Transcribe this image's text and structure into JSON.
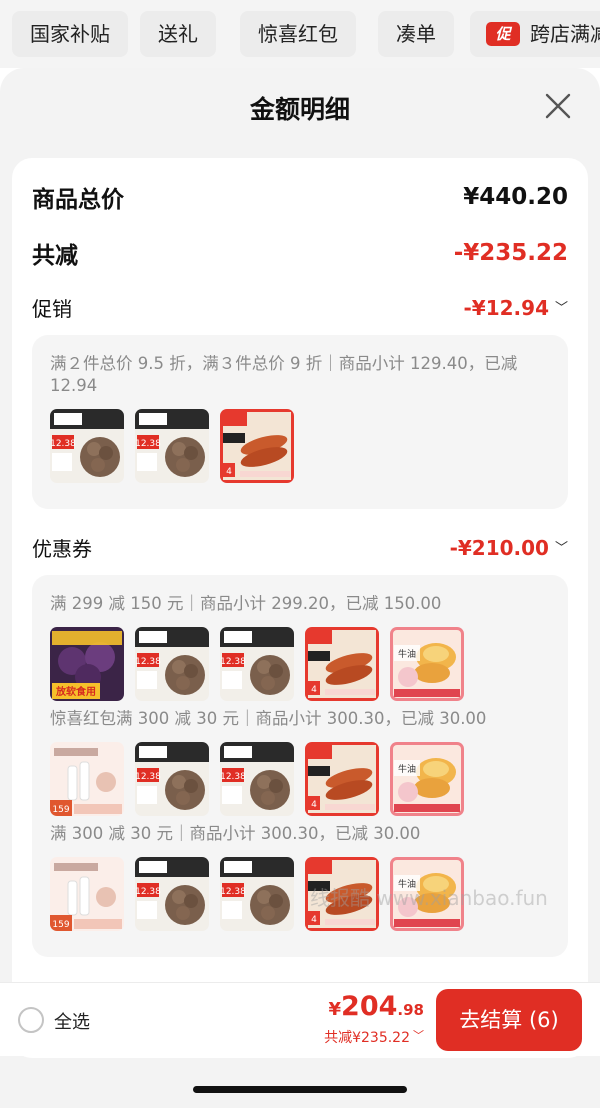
{
  "top_tabs": {
    "items": [
      "国家补贴",
      "送礼",
      "惊喜红包",
      "凑单"
    ],
    "promo_badge": "促",
    "promo_label": "跨店满减"
  },
  "sheet": {
    "title": "金额明细",
    "close_icon": "close-icon"
  },
  "summary": {
    "goods_total_label": "商品总价",
    "goods_total_value": "¥440.20",
    "reduce_label": "共减",
    "reduce_value": "-¥235.22"
  },
  "promotion": {
    "label": "促销",
    "value": "-¥12.94",
    "rule": "满２件总价 9.5 折，满３件总价 9 折｜商品小计 129.40，已减 12.94",
    "thumbs": [
      {
        "type": "beef",
        "tag": "12.38"
      },
      {
        "type": "beef",
        "tag": "12.38"
      },
      {
        "type": "sausage",
        "tag": "4"
      }
    ]
  },
  "coupons": {
    "label": "优惠券",
    "value": "-¥210.00",
    "groups": [
      {
        "rule": "满 299 减 150 元｜商品小计 299.20，已减 150.00",
        "thumbs": [
          {
            "type": "plum",
            "tag": "放软食用"
          },
          {
            "type": "beef",
            "tag": "12.38"
          },
          {
            "type": "beef",
            "tag": "12.38"
          },
          {
            "type": "sausage",
            "tag": "4"
          },
          {
            "type": "tart",
            "tag": "牛油"
          }
        ]
      },
      {
        "rule": "惊喜红包满 300 减 30 元｜商品小计 300.30，已减 30.00",
        "thumbs": [
          {
            "type": "cosmetic",
            "tag": "159"
          },
          {
            "type": "beef",
            "tag": "12.38"
          },
          {
            "type": "beef",
            "tag": "12.38"
          },
          {
            "type": "sausage",
            "tag": "4"
          },
          {
            "type": "tart",
            "tag": "牛油"
          }
        ]
      },
      {
        "rule": "满 300 减 30 元｜商品小计 300.30，已减 30.00",
        "thumbs": [
          {
            "type": "cosmetic",
            "tag": "159"
          },
          {
            "type": "beef",
            "tag": "12.38"
          },
          {
            "type": "beef",
            "tag": "12.38"
          },
          {
            "type": "sausage",
            "tag": "4"
          },
          {
            "type": "tart",
            "tag": "牛油"
          }
        ]
      }
    ]
  },
  "bottom_bar": {
    "select_all_label": "全选",
    "price_currency": "¥",
    "price_integer": "204",
    "price_decimal": ".98",
    "total_reduce": "共减¥235.22",
    "checkout_label": "去结算 (6)"
  },
  "watermark": "线报酷  www.xianbao.fun",
  "colors": {
    "accent": "#e02e24",
    "sheet_bg": "#f3f3f3",
    "muted_text": "#8a8a8a"
  }
}
